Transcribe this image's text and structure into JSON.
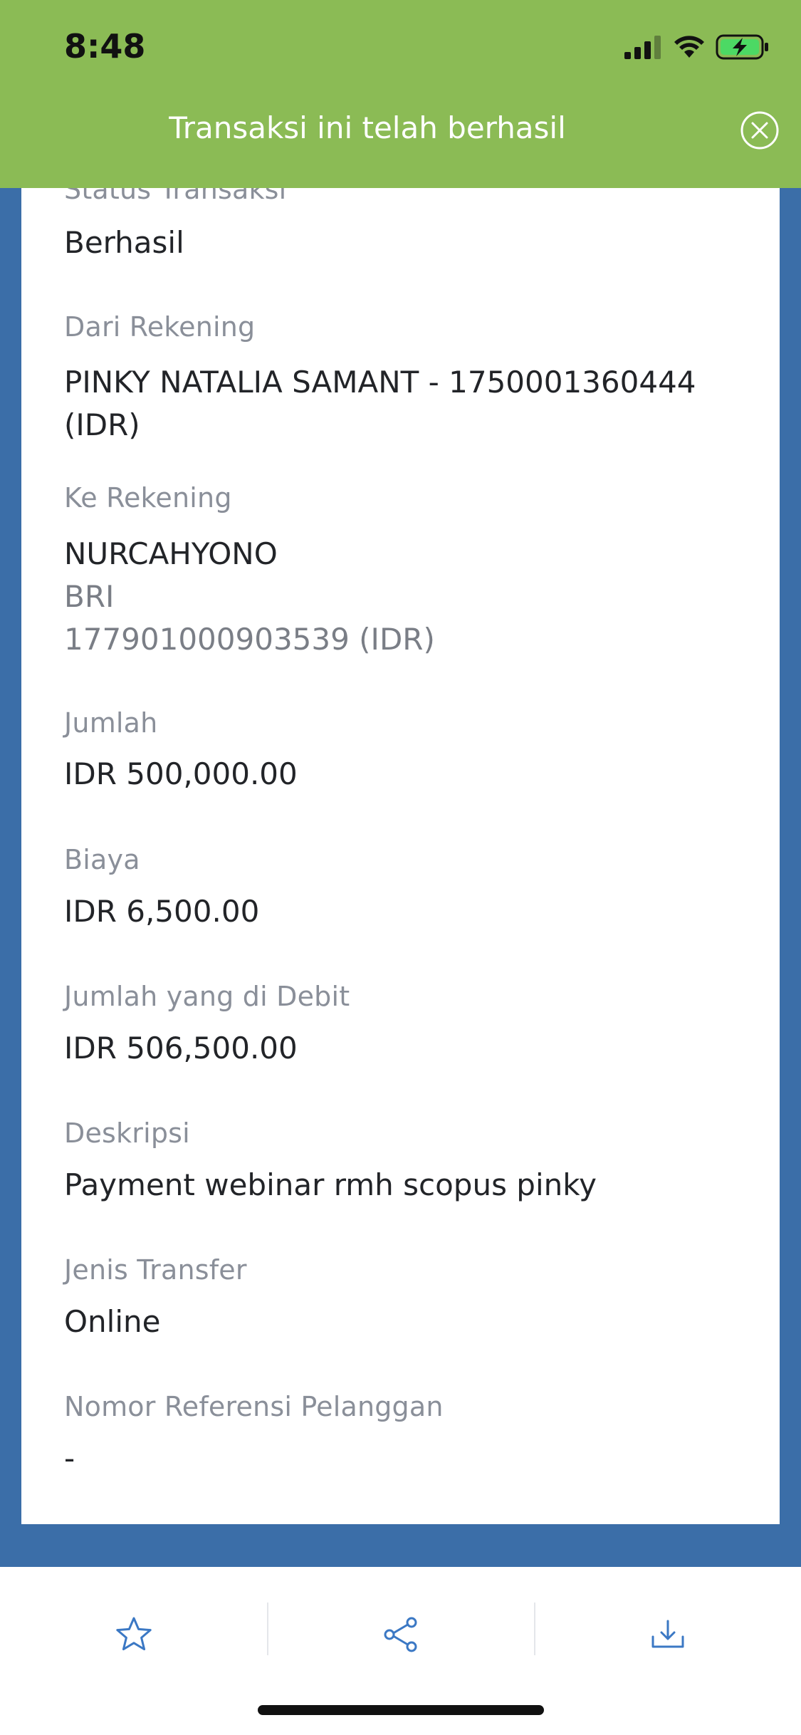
{
  "status_bar": {
    "time": "8:48",
    "icons": [
      "cellular-signal-icon",
      "wifi-icon",
      "battery-charging-icon"
    ]
  },
  "banner": {
    "message": "Transaksi ini telah berhasil",
    "close_icon": "close-circle-icon",
    "color": "#8bbb55"
  },
  "details": {
    "status": {
      "label": "Status Transaksi",
      "value": "Berhasil"
    },
    "from_account": {
      "label": "Dari Rekening",
      "line1": "PINKY NATALIA SAMANT - 1750001360444",
      "line2": "(IDR)"
    },
    "to_account": {
      "label": "Ke Rekening",
      "name": "NURCAHYONO",
      "bank": "BRI",
      "number": "177901000903539 (IDR)"
    },
    "amount": {
      "label": "Jumlah",
      "value": "IDR 500,000.00"
    },
    "fee": {
      "label": "Biaya",
      "value": "IDR 6,500.00"
    },
    "debited": {
      "label": "Jumlah yang di Debit",
      "value": "IDR 506,500.00"
    },
    "description": {
      "label": "Deskripsi",
      "value": "Payment webinar rmh scopus pinky"
    },
    "transfer_type": {
      "label": "Jenis Transfer",
      "value": "Online"
    },
    "customer_ref": {
      "label": "Nomor Referensi Pelanggan",
      "value": "-"
    }
  },
  "toolbar": {
    "buttons": [
      "star-icon",
      "share-icon",
      "download-icon"
    ],
    "icon_color": "#3b78c4"
  },
  "colors": {
    "page_background": "#3b6ea8",
    "card": "#ffffff",
    "label_text": "#8a8f99",
    "value_text": "#222428"
  }
}
